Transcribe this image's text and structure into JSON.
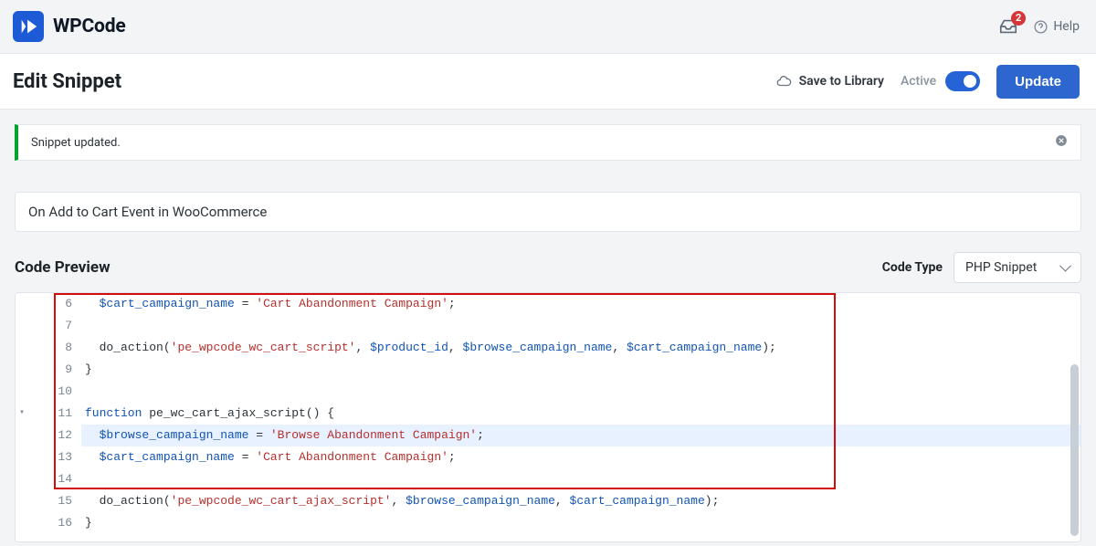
{
  "brand": {
    "name": "WPCode"
  },
  "topbar": {
    "notifications_count": "2",
    "help_label": "Help"
  },
  "header": {
    "page_title": "Edit Snippet",
    "save_library_label": "Save to Library",
    "active_label": "Active",
    "update_label": "Update"
  },
  "notice": {
    "message": "Snippet updated."
  },
  "snippet": {
    "name": "On Add to Cart Event in WooCommerce"
  },
  "code_preview": {
    "label": "Code Preview",
    "code_type_label": "Code Type",
    "code_type_value": "PHP Snippet"
  },
  "code_lines": {
    "l6": "  $cart_campaign_name = 'Cart Abandonment Campaign';",
    "l6_var": "$cart_campaign_name",
    "l6_str": "'Cart Abandonment Campaign'",
    "l7": "",
    "l8_fn": "do_action",
    "l8_arg_str": "'pe_wpcode_wc_cart_script'",
    "l8_v1": "$product_id",
    "l8_v2": "$browse_campaign_name",
    "l8_v3": "$cart_campaign_name",
    "l9": "}",
    "l10": "",
    "l11_kw": "function",
    "l11_name": "pe_wc_cart_ajax_script",
    "l12_var": "$browse_campaign_name",
    "l12_str": "'Browse Abandonment Campaign'",
    "l13_var": "$cart_campaign_name",
    "l13_str": "'Cart Abandonment Campaign'",
    "l14": "",
    "l15_fn": "do_action",
    "l15_arg_str": "'pe_wpcode_wc_cart_ajax_script'",
    "l15_v1": "$browse_campaign_name",
    "l15_v2": "$cart_campaign_name",
    "l16": "}"
  },
  "line_numbers": {
    "n6": "6",
    "n7": "7",
    "n8": "8",
    "n9": "9",
    "n10": "10",
    "n11": "11",
    "n12": "12",
    "n13": "13",
    "n14": "14",
    "n15": "15",
    "n16": "16"
  }
}
